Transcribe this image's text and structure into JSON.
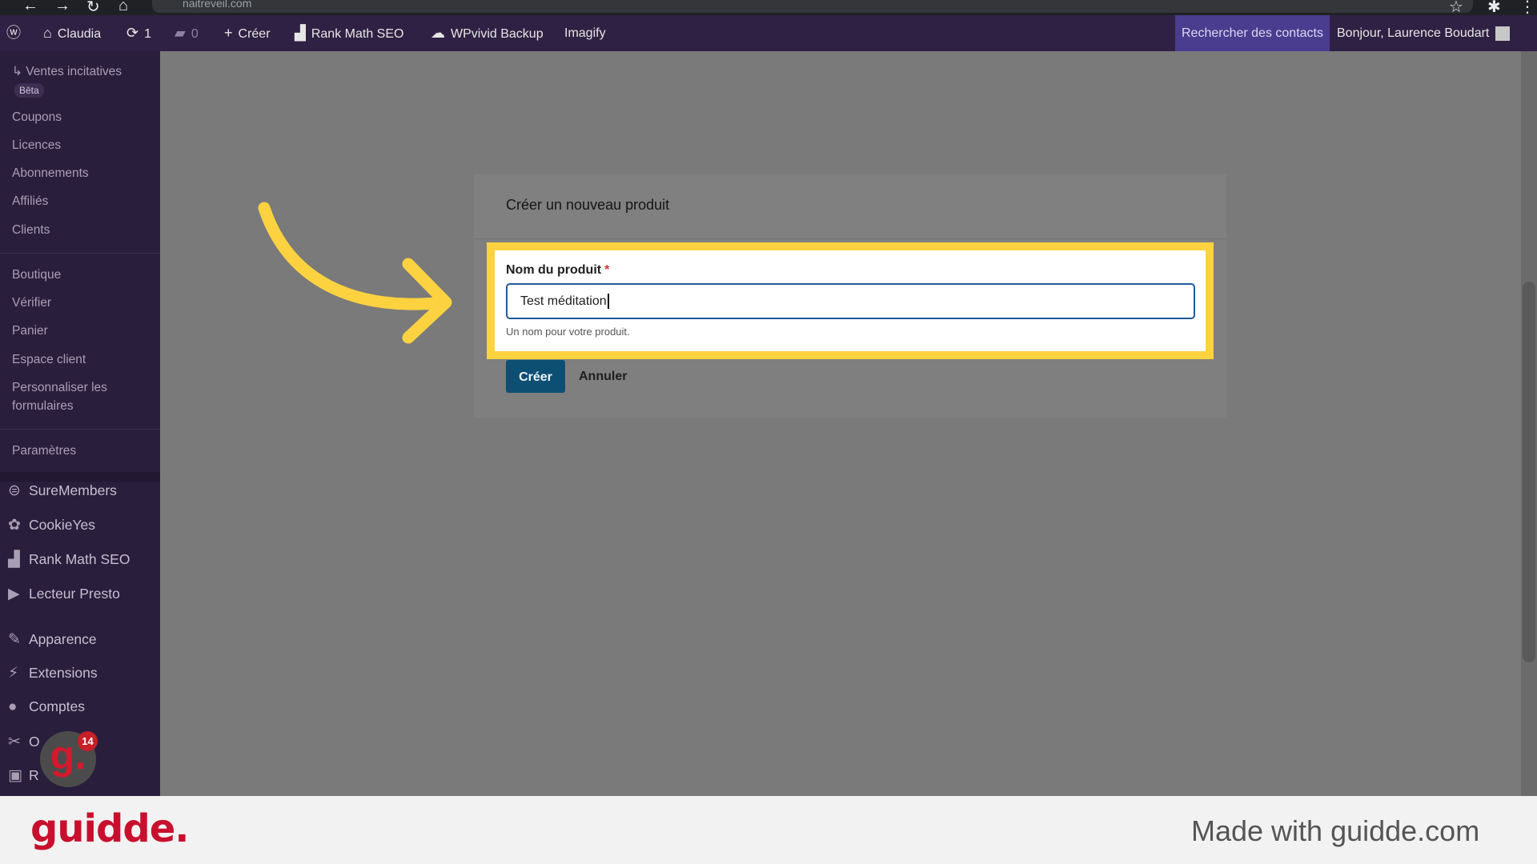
{
  "browser": {
    "url": "naitreveil.com"
  },
  "admin_bar": {
    "site_name": "Claudia",
    "updates_count": "1",
    "comments_count": "0",
    "new_label": "Créer",
    "rank_math": "Rank Math SEO",
    "wpvivid": "WPvivid Backup",
    "imagify": "Imagify",
    "search_contacts": "Rechercher des contacts",
    "greeting": "Bonjour, Laurence Boudart"
  },
  "sidebar": {
    "submenu": [
      "↳ Ventes incitatives",
      "Coupons",
      "Licences",
      "Abonnements",
      "Affiliés",
      "Clients",
      "Boutique",
      "Vérifier",
      "Panier",
      "Espace client",
      "Personnaliser les",
      "formulaires",
      "Paramètres"
    ],
    "beta_badge": "Bêta",
    "menu": [
      "SureMembers",
      "CookieYes",
      "Rank Math SEO",
      "Lecteur Presto",
      "Apparence",
      "Extensions",
      "Comptes",
      "O",
      "R"
    ],
    "notification_count": "14",
    "guidde_letter": "g."
  },
  "dialog": {
    "title": "Créer un nouveau produit",
    "field_label": "Nom du produit",
    "required_mark": "*",
    "field_value": "Test méditation",
    "help_text": "Un nom pour votre produit.",
    "create_button": "Créer",
    "cancel_button": "Annuler"
  },
  "footer": {
    "logo": "guidde.",
    "made_with": "Made with guidde.com"
  },
  "colors": {
    "admin_bar": "#2f2143",
    "sidebar": "#2a1e3d",
    "highlight": "#fcd240",
    "primary_button": "#0d4f73",
    "guidde_red": "#c8102e"
  }
}
